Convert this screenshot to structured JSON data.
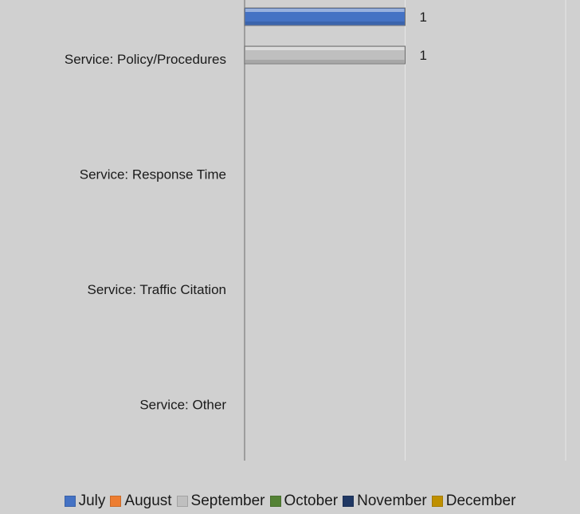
{
  "chart_data": {
    "type": "bar",
    "orientation": "horizontal",
    "categories": [
      "Service: Policy/Procedures",
      "Service: Response Time",
      "Service: Traffic Citation",
      "Service: Other"
    ],
    "series": [
      {
        "name": "July",
        "color": "#4472c4",
        "values": [
          1,
          0,
          0,
          0
        ]
      },
      {
        "name": "August",
        "color": "#ed7d31",
        "values": [
          0,
          0,
          0,
          0
        ]
      },
      {
        "name": "September",
        "color": "#bfbfbf",
        "values": [
          1,
          0,
          0,
          0
        ]
      },
      {
        "name": "October",
        "color": "#548235",
        "values": [
          0,
          0,
          0,
          0
        ]
      },
      {
        "name": "November",
        "color": "#203864",
        "values": [
          0,
          0,
          0,
          0
        ]
      },
      {
        "name": "December",
        "color": "#bf9000",
        "values": [
          0,
          0,
          0,
          0
        ]
      }
    ],
    "data_labels": [
      {
        "series": "July",
        "category": "Service: Policy/Procedures",
        "text": "1"
      },
      {
        "series": "September",
        "category": "Service: Policy/Procedures",
        "text": "1"
      }
    ],
    "xlim": [
      0,
      2
    ],
    "grid": true,
    "legend_position": "bottom"
  }
}
